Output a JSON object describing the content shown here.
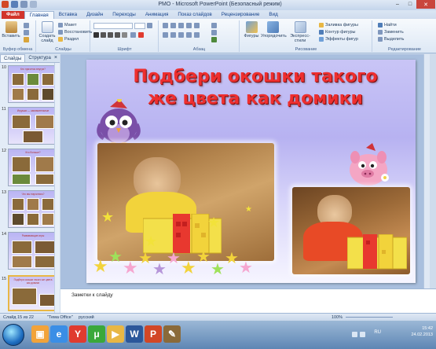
{
  "window": {
    "title": "PMO - Microsoft PowerPoint (Безопасный режим)",
    "minimize": "–",
    "maximize": "□",
    "close": "✕"
  },
  "ribbon_tabs": [
    "Файл",
    "Главная",
    "Вставка",
    "Дизайн",
    "Переходы",
    "Анимация",
    "Показ слайдов",
    "Рецензирование",
    "Вид"
  ],
  "ribbon": {
    "clipboard": {
      "paste": "Вставить",
      "label": "Буфер обмена"
    },
    "slides": {
      "new_slide": "Создать слайд",
      "layout": "Макет",
      "reset": "Восстановить",
      "section": "Раздел",
      "label": "Слайды"
    },
    "font": {
      "label": "Шрифт"
    },
    "paragraph": {
      "label": "Абзац"
    },
    "drawing": {
      "shapes": "Фигуры",
      "arrange": "Упорядочить",
      "quick_styles": "Экспресс-стили",
      "fill": "Заливка фигуры",
      "outline": "Контур фигуры",
      "effects": "Эффекты фигур",
      "label": "Рисование"
    },
    "editing": {
      "find": "Найти",
      "replace": "Заменить",
      "select": "Выделить",
      "label": "Редактирование"
    }
  },
  "side_panel": {
    "tabs": [
      "Слайды",
      "Структура"
    ],
    "close": "×",
    "thumbnails": [
      {
        "num": "10",
        "caption": "Кто прячется внутри?"
      },
      {
        "num": "11",
        "caption": "Игрушки — занимательные"
      },
      {
        "num": "12",
        "caption": "Кто больше?"
      },
      {
        "num": "13",
        "caption": "Что мы научились?"
      },
      {
        "num": "14",
        "caption": "Развивающие игры"
      },
      {
        "num": "15",
        "caption": "Подбери окошки такого же цвета как домики"
      }
    ]
  },
  "slide": {
    "title_line1": "Подбери окошки такого",
    "title_line2": "же цвета как домики"
  },
  "notes": {
    "placeholder": "Заметки к слайду"
  },
  "status": {
    "slide_info": "Слайд 15 из 22",
    "theme": "\"Тема Office\"",
    "language": "русский",
    "zoom": "100%"
  },
  "taskbar": {
    "lang": "RU",
    "time": "15:42",
    "date": "24.02.2013"
  },
  "colors": {
    "title_red": "#ee2f2f",
    "file_tab": "#d2342b",
    "slide_bg": "#b7b2f1"
  }
}
